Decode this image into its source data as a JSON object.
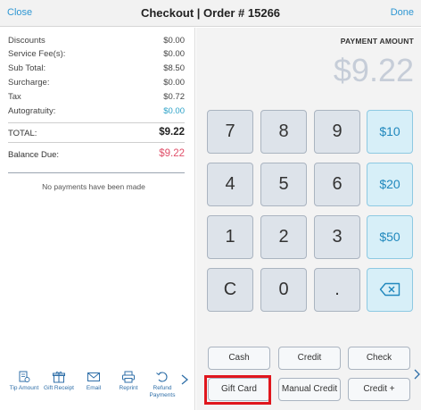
{
  "header": {
    "close_label": "Close",
    "title": "Checkout | Order # 15266",
    "done_label": "Done"
  },
  "summary": {
    "rows": [
      {
        "label": "Discounts",
        "value": "$0.00"
      },
      {
        "label": "Service Fee(s):",
        "value": "$0.00"
      },
      {
        "label": "Sub Total:",
        "value": "$8.50"
      },
      {
        "label": "Surcharge:",
        "value": "$0.00"
      },
      {
        "label": "Tax",
        "value": "$0.72"
      },
      {
        "label": "Autogratuity:",
        "value": "$0.00"
      }
    ],
    "total_label": "TOTAL:",
    "total_value": "$9.22",
    "balance_label": "Balance Due:",
    "balance_value": "$9.22",
    "no_payments_text": "No payments have been made"
  },
  "tools": [
    {
      "label": "Tip Amount",
      "icon": "receipt-icon"
    },
    {
      "label": "Gift Receipt",
      "icon": "gift-icon"
    },
    {
      "label": "Email",
      "icon": "envelope-icon"
    },
    {
      "label": "Reprint",
      "icon": "printer-icon"
    },
    {
      "label": "Refund Payments",
      "icon": "refund-icon"
    }
  ],
  "payment": {
    "label": "PAYMENT AMOUNT",
    "amount": "$9.22",
    "keys": [
      "7",
      "8",
      "9",
      "4",
      "5",
      "6",
      "1",
      "2",
      "3",
      "C",
      "0",
      "."
    ],
    "quick_amounts": [
      "$10",
      "$20",
      "$50"
    ],
    "methods_row1": [
      "Cash",
      "Credit",
      "Check"
    ],
    "methods_row2": [
      "Gift Card",
      "Manual Credit",
      "Credit +"
    ]
  },
  "colors": {
    "accent": "#2f97d3",
    "balance": "#e0506a",
    "highlight": "#e0161d",
    "quick_key_bg": "#d7eff8"
  }
}
